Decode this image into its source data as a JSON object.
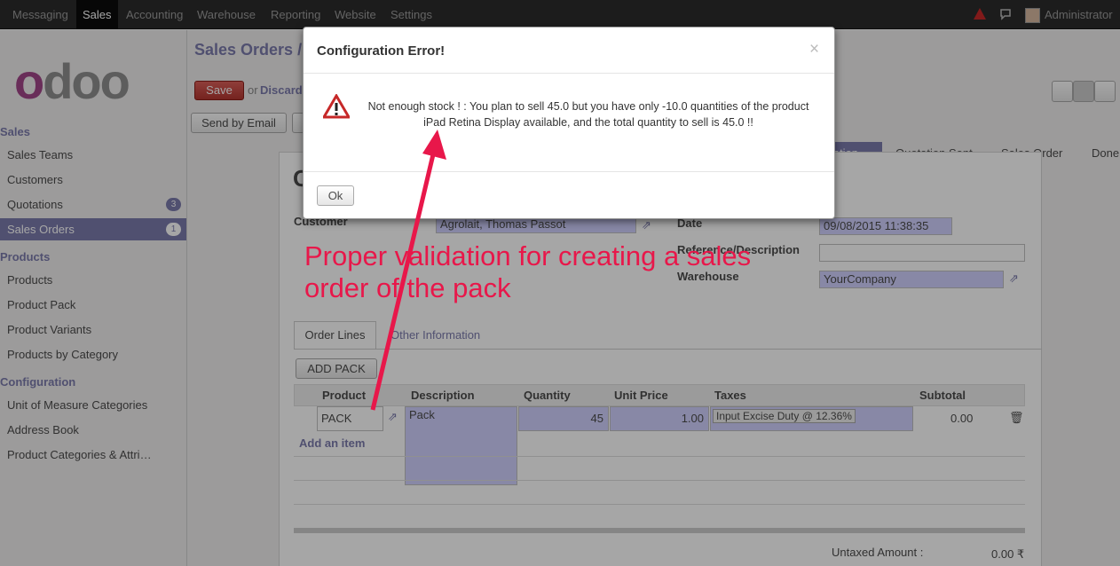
{
  "topbar": {
    "menus": [
      "Messaging",
      "Sales",
      "Accounting",
      "Warehouse",
      "Reporting",
      "Website",
      "Settings"
    ],
    "active_menu": "Sales",
    "user": "Administrator"
  },
  "sidebar": {
    "logo": "odoo",
    "sections": [
      {
        "title": "Sales",
        "items": [
          {
            "label": "Sales Teams"
          },
          {
            "label": "Customers"
          },
          {
            "label": "Quotations",
            "badge": "3"
          },
          {
            "label": "Sales Orders",
            "badge": "1"
          }
        ]
      },
      {
        "title": "Products",
        "items": [
          {
            "label": "Products"
          },
          {
            "label": "Product Pack"
          },
          {
            "label": "Product Variants"
          },
          {
            "label": "Products by Category"
          }
        ]
      },
      {
        "title": "Configuration",
        "items": [
          {
            "label": "Unit of Measure Categories"
          },
          {
            "label": "Address Book"
          },
          {
            "label": "Product Categories & Attri…"
          }
        ]
      }
    ]
  },
  "main": {
    "breadcrumb": "Sales Orders /",
    "save_label": "Save",
    "or_label": "or",
    "discard_label": "Discard",
    "send_email_label": "Send by Email",
    "stages": [
      "otation",
      "Quotation Sent",
      "Sales Order",
      "Done"
    ],
    "form": {
      "title_initial": "C",
      "customer_label": "Customer",
      "customer_value": "Agrolait, Thomas Passot",
      "date_label": "Date",
      "date_value": "09/08/2015 11:38:35",
      "ref_label": "Reference/Description",
      "warehouse_label": "Warehouse",
      "warehouse_value": "YourCompany",
      "tabs": [
        "Order Lines",
        "Other Information"
      ],
      "add_pack_label": "ADD PACK",
      "columns": [
        "Product",
        "Description",
        "Quantity",
        "Unit Price",
        "Taxes",
        "Subtotal"
      ],
      "line": {
        "product": "PACK",
        "description": "Pack",
        "quantity": "45",
        "unit_price": "1.00",
        "tax": "Input Excise Duty @ 12.36%",
        "subtotal": "0.00"
      },
      "add_item_label": "Add an item",
      "untaxed_label": "Untaxed Amount :",
      "untaxed_value": "0.00 ₹"
    }
  },
  "modal": {
    "title": "Configuration Error!",
    "close": "×",
    "message_line1": "Not enough stock ! : You plan to sell 45.0 but you have only -10.0 quantities of the product",
    "message_line2": "iPad Retina Display available, and the total quantity to sell is 45.0 !!",
    "ok_label": "Ok"
  },
  "annotation": {
    "line1": "Proper validation for creating a sales",
    "line2": "order of the pack",
    "color": "#e8174a"
  }
}
